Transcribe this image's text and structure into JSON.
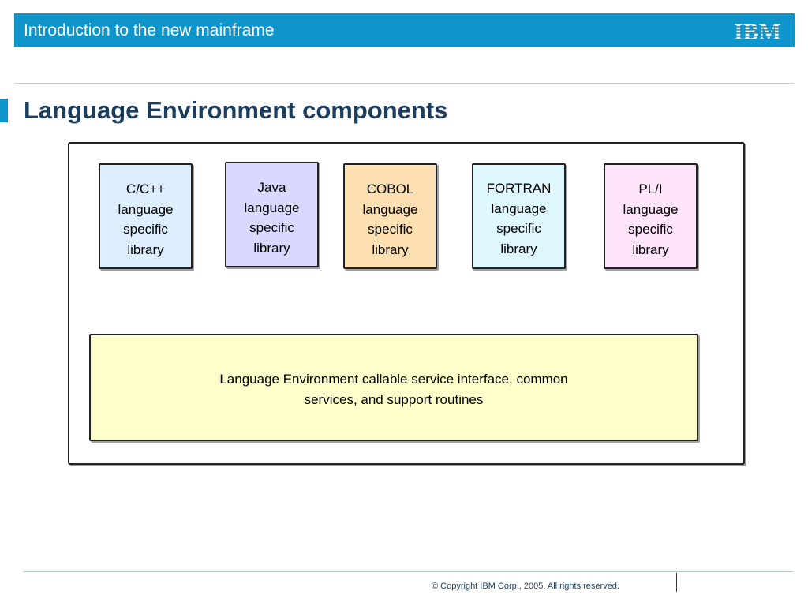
{
  "header": {
    "title": "Introduction to the new mainframe",
    "logo_text": "IBM",
    "bar_color": "#0d95cc"
  },
  "slide": {
    "title": "Language Environment components"
  },
  "diagram": {
    "libraries": [
      {
        "lines": [
          "C/C++",
          "language",
          "specific",
          "library"
        ],
        "fill": "#ddeeff"
      },
      {
        "lines": [
          "Java",
          "language",
          "specific",
          "library"
        ],
        "fill": "#d9d9ff"
      },
      {
        "lines": [
          "COBOL",
          "language",
          "specific",
          "library"
        ],
        "fill": "#fde0b2"
      },
      {
        "lines": [
          "FORTRAN",
          "language",
          "specific",
          "library"
        ],
        "fill": "#dff8ff"
      },
      {
        "lines": [
          "PL/I",
          "language",
          "specific",
          "library"
        ],
        "fill": "#ffe5fb"
      }
    ],
    "service": {
      "lines": [
        "Language Environment callable service interface, common",
        "services, and support routines"
      ],
      "fill": "#ffffcc"
    }
  },
  "footer": {
    "copyright": "© Copyright IBM Corp., 2005. All rights reserved."
  }
}
